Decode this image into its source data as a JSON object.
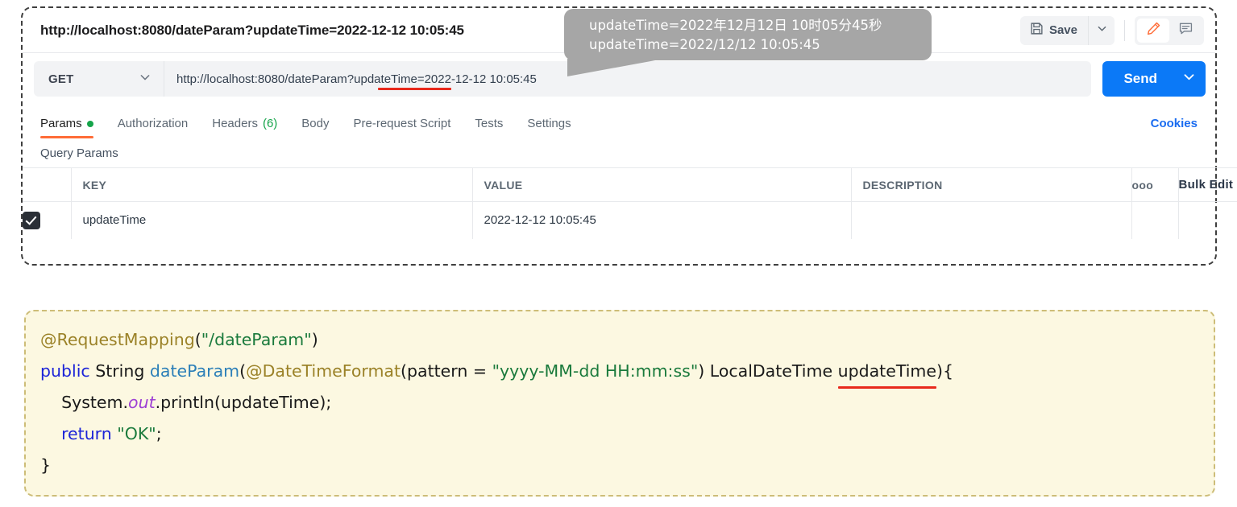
{
  "request": {
    "name": "http://localhost:8080/dateParam?updateTime=2022-12-12 10:05:45",
    "save_label": "Save",
    "method": "GET",
    "url_prefix": "http://localhost:8080/dateParam?",
    "url_param_name": "updateTime",
    "url_suffix": "=2022-12-12 10:05:45",
    "send_label": "Send"
  },
  "tabs": [
    {
      "label": "Params",
      "badge": "dot",
      "active": true
    },
    {
      "label": "Authorization",
      "badge": "",
      "active": false
    },
    {
      "label": "Headers",
      "badge": "(6)",
      "active": false
    },
    {
      "label": "Body",
      "badge": "",
      "active": false
    },
    {
      "label": "Pre-request Script",
      "badge": "",
      "active": false
    },
    {
      "label": "Tests",
      "badge": "",
      "active": false
    },
    {
      "label": "Settings",
      "badge": "",
      "active": false
    }
  ],
  "cookies_label": "Cookies",
  "query_params": {
    "section_label": "Query Params",
    "headers": {
      "key": "KEY",
      "value": "VALUE",
      "description": "DESCRIPTION",
      "more": "ooo",
      "bulk_edit": "Bulk Edit"
    },
    "rows": [
      {
        "checked": true,
        "key": "updateTime",
        "value": "2022-12-12 10:05:45",
        "description": ""
      }
    ]
  },
  "tooltip": {
    "line1": "updateTime=2022年12月12日 10时05分45秒",
    "line2": "updateTime=2022/12/12 10:05:45"
  },
  "code": {
    "line1_anno": "@RequestMapping",
    "line1_paren_open": "(",
    "line1_str": "\"/dateParam\"",
    "line1_paren_close": ")",
    "line2_kw": "public",
    "line2_type": " String ",
    "line2_method": "dateParam",
    "line2_p1": "(",
    "line2_anno": "@DateTimeFormat",
    "line2_p2": "(pattern = ",
    "line2_str": "\"yyyy-MM-dd HH:mm:ss\"",
    "line2_p3": ") LocalDateTime ",
    "line2_param": "updateTime",
    "line2_p4": "){",
    "line3_a": "    System.",
    "line3_static": "out",
    "line3_b": ".println(updateTime);",
    "line4_kw": "    return ",
    "line4_str": "\"OK\"",
    "line4_end": ";",
    "line5": "}"
  },
  "colors": {
    "accent_orange": "#ff6c37",
    "send_blue": "#0b79f7",
    "link_blue": "#1a6cf0",
    "green_badge": "#15a44a",
    "underline_red": "#e8291c",
    "code_bg": "#fcf8e1",
    "code_border": "#cdbd78",
    "tooltip_bg": "#a6a6a6"
  }
}
